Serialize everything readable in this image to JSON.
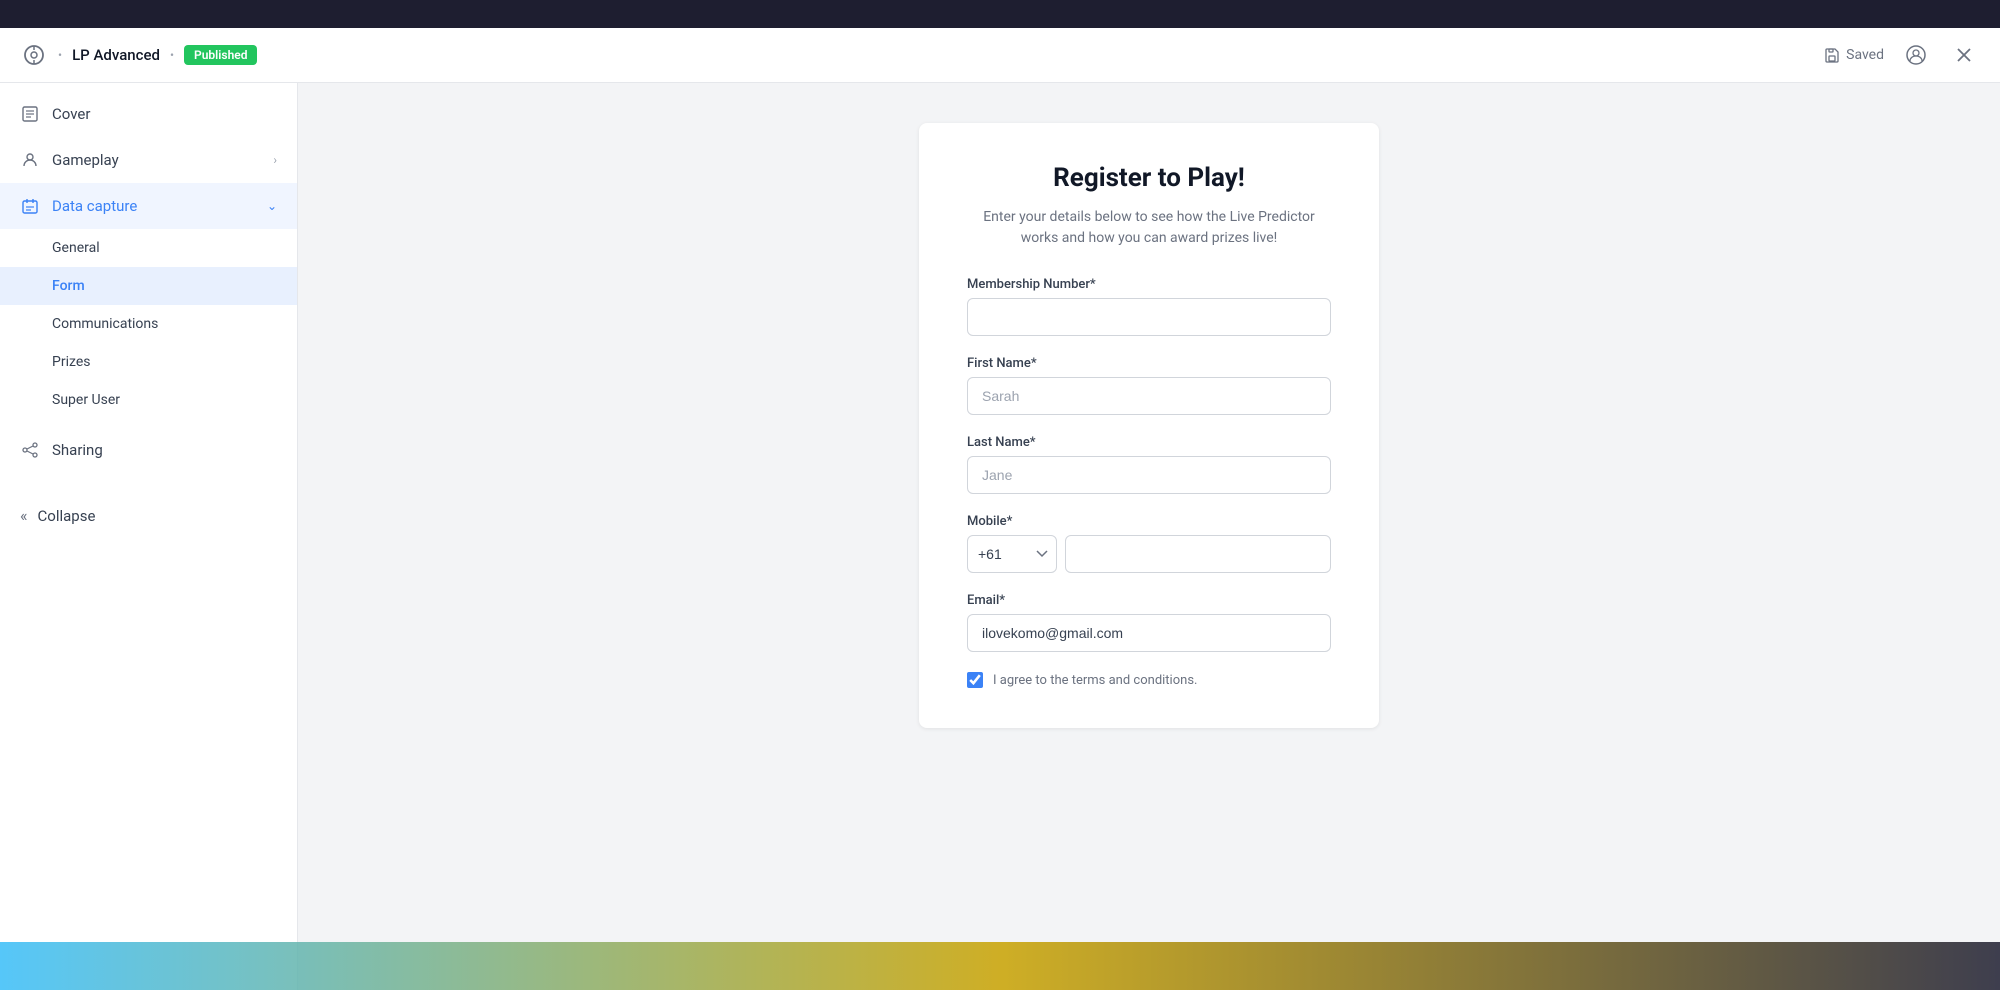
{
  "header": {
    "icon_label": "predictor-icon",
    "title": "LP Advanced",
    "status": "Published",
    "saved_label": "Saved",
    "close_label": "×"
  },
  "sidebar": {
    "items": [
      {
        "id": "cover",
        "label": "Cover",
        "icon": "document-icon",
        "active": false,
        "has_chevron": false
      },
      {
        "id": "gameplay",
        "label": "Gameplay",
        "icon": "person-icon",
        "active": false,
        "has_chevron": true
      },
      {
        "id": "data-capture",
        "label": "Data capture",
        "icon": "capture-icon",
        "active": true,
        "has_chevron": true
      }
    ],
    "sub_items": [
      {
        "id": "general",
        "label": "General",
        "active": false
      },
      {
        "id": "form",
        "label": "Form",
        "active": true
      },
      {
        "id": "communications",
        "label": "Communications",
        "active": false
      },
      {
        "id": "prizes",
        "label": "Prizes",
        "active": false
      },
      {
        "id": "super-user",
        "label": "Super User",
        "active": false
      }
    ],
    "bottom_items": [
      {
        "id": "sharing",
        "label": "Sharing",
        "icon": "share-icon"
      }
    ],
    "collapse_label": "Collapse"
  },
  "form": {
    "title": "Register to Play!",
    "subtitle": "Enter your details below to see how the Live Predictor works and how you can award prizes live!",
    "fields": [
      {
        "id": "membership",
        "label": "Membership Number*",
        "placeholder": "",
        "type": "text",
        "value": ""
      },
      {
        "id": "first-name",
        "label": "First Name*",
        "placeholder": "Sarah",
        "type": "text",
        "value": ""
      },
      {
        "id": "last-name",
        "label": "Last Name*",
        "placeholder": "Jane",
        "type": "text",
        "value": ""
      },
      {
        "id": "mobile",
        "label": "Mobile*",
        "placeholder": "",
        "type": "mobile",
        "country_code": "+61",
        "value": ""
      },
      {
        "id": "email",
        "label": "Email*",
        "placeholder": "",
        "type": "email",
        "value": "ilovekomo@gmail.com"
      }
    ],
    "checkbox": {
      "checked": true,
      "label": "I agree to the terms and conditions."
    }
  }
}
